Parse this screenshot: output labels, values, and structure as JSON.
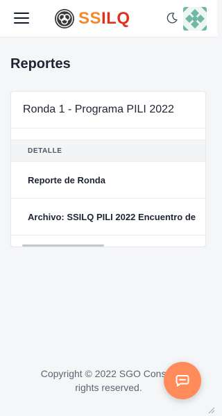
{
  "header": {
    "logo_prefix": "SS",
    "logo_suffix": "ILQ",
    "icons": [
      "hamburger-icon",
      "logo-knot-icon",
      "moon-icon",
      "avatar"
    ]
  },
  "page": {
    "title": "Reportes"
  },
  "card": {
    "title": "Ronda 1 - Programa PILI 2022",
    "table": {
      "header": "DETALLE",
      "rows": [
        "Reporte de Ronda",
        "Archivo: SSILQ PILI 2022 Encuentro de"
      ]
    }
  },
  "footer": {
    "line1": "Copyright © 2022 SGO Consult",
    "line2": "rights reserved."
  },
  "colors": {
    "accent_orange": "#f08a2c",
    "accent_red": "#e0301e",
    "chat_button": "#ff8b5a"
  }
}
